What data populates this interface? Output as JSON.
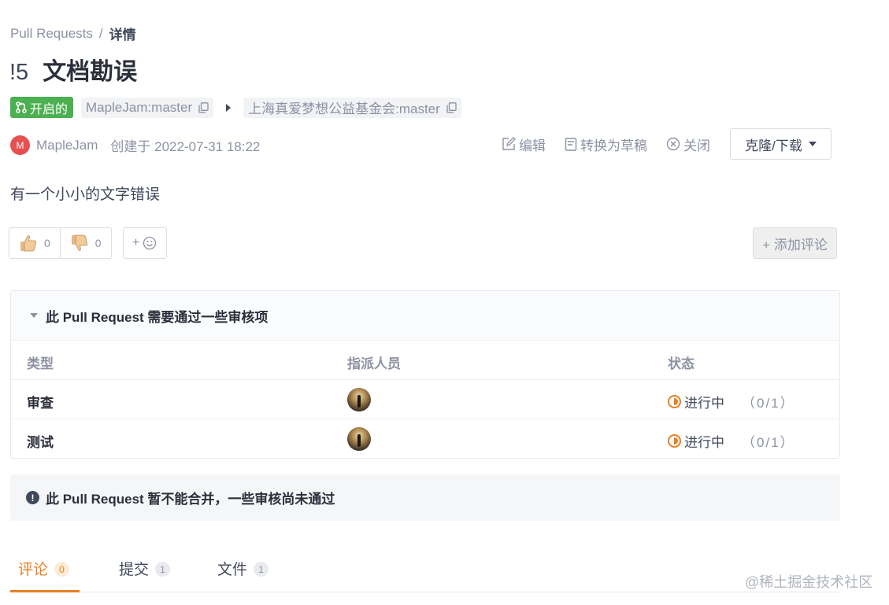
{
  "breadcrumb": {
    "root": "Pull Requests",
    "separator": "/",
    "current": "详情"
  },
  "pr": {
    "number": "!5",
    "title": "文档勘误"
  },
  "status_badge": {
    "label": "开启的",
    "color": "#4caf50"
  },
  "branches": {
    "source": "MapleJam:master",
    "target": "上海真爱梦想公益基金会:master"
  },
  "author": {
    "avatar_letter": "M",
    "name": "MapleJam",
    "created": "创建于 2022-07-31 18:22"
  },
  "actions": {
    "edit": "编辑",
    "draft": "转换为草稿",
    "close": "关闭",
    "clone": "克隆/下载"
  },
  "description": "有一个小小的文字错误",
  "reactions": {
    "thumbs_up": "0",
    "thumbs_down": "0",
    "add_emoji": "+"
  },
  "add_comment": "+ 添加评论",
  "review": {
    "header": "此 Pull Request 需要通过一些审核项",
    "columns": {
      "type": "类型",
      "assignee": "指派人员",
      "status": "状态"
    },
    "rows": [
      {
        "type": "审查",
        "status": "进行中",
        "progress": "（0/1）"
      },
      {
        "type": "测试",
        "status": "进行中",
        "progress": "（0/1）"
      }
    ]
  },
  "merge_warning": "此 Pull Request 暂不能合并，一些审核尚未通过",
  "tabs": [
    {
      "label": "评论",
      "count": "0"
    },
    {
      "label": "提交",
      "count": "1"
    },
    {
      "label": "文件",
      "count": "1"
    }
  ],
  "watermark": "@稀土掘金技术社区",
  "colors": {
    "accent": "#e87f22",
    "open": "#4caf50",
    "text": "#40485b",
    "muted": "#8c92a4"
  }
}
